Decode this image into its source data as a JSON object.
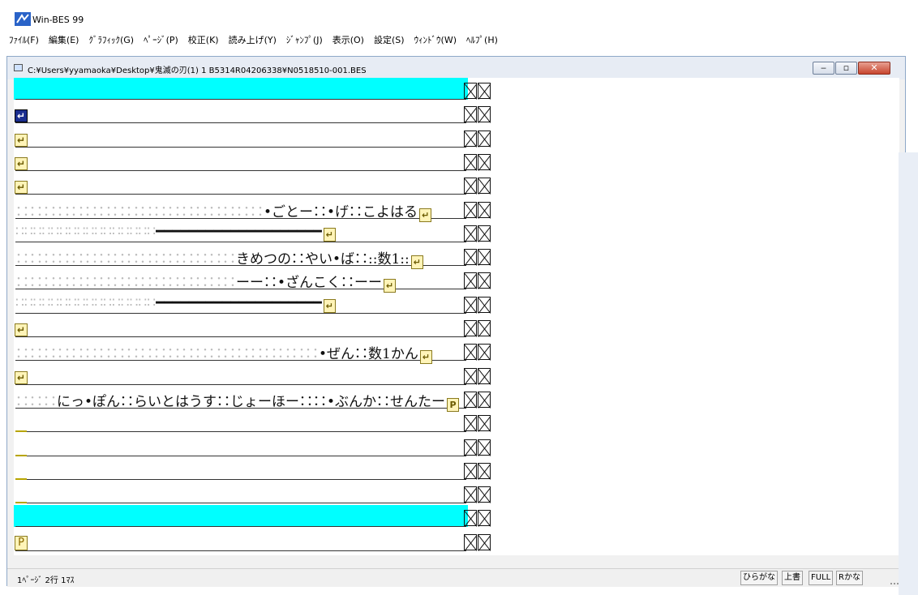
{
  "app": {
    "title": "Win-BES 99"
  },
  "menu": [
    "ﾌｧｲﾙ(F)",
    "編集(E)",
    "ｸﾞﾗﾌｨｯｸ(G)",
    "ﾍﾟｰｼﾞ(P)",
    "校正(K)",
    "読み上げ(Y)",
    "ｼﾞｬﾝﾌﾟ(J)",
    "表示(O)",
    "設定(S)",
    "ｳｨﾝﾄﾞｳ(W)",
    "ﾍﾙﾌﾟ(H)"
  ],
  "document": {
    "title": "C:¥Users¥yyamaoka¥Desktop¥鬼滅の刃(1) 1 B5314R04206338¥N0518510-001.BES",
    "rows": [
      {
        "kind": "highlight",
        "text": ""
      },
      {
        "kind": "return-cursor",
        "text": ""
      },
      {
        "kind": "return",
        "text": ""
      },
      {
        "kind": "return",
        "text": ""
      },
      {
        "kind": "return",
        "text": ""
      },
      {
        "kind": "text",
        "lead": "∷∷∷∷∷∷∷∷∷∷∷∷∷∷∷∷∷∷",
        "text": "•ごとー∷•げ∷こよはる",
        "end": "return"
      },
      {
        "kind": "text",
        "lead": "∷∷∷∷∷∷∷∷∷∷∷∷∷∷∷∷",
        "text": "━━━━━━━━━━━━━━━━━━━━",
        "end": "return"
      },
      {
        "kind": "text",
        "lead": "∷∷∷∷∷∷∷∷∷∷∷∷∷∷∷∷",
        "text": "きめつの∷やい•ば∷::数1::",
        "end": "return"
      },
      {
        "kind": "text",
        "lead": "∷∷∷∷∷∷∷∷∷∷∷∷∷∷∷∷",
        "text": "ーー∷•ざんこく∷ーー",
        "end": "return"
      },
      {
        "kind": "text",
        "lead": "∷∷∷∷∷∷∷∷∷∷∷∷∷∷∷∷",
        "text": "━━━━━━━━━━━━━━━━━━━━",
        "end": "return"
      },
      {
        "kind": "return",
        "text": ""
      },
      {
        "kind": "text",
        "lead": "∷∷∷∷∷∷∷∷∷∷∷∷∷∷∷∷∷∷∷∷∷∷",
        "text": "•ぜん∷数1かん",
        "end": "return"
      },
      {
        "kind": "return",
        "text": ""
      },
      {
        "kind": "text",
        "lead": "∷∷∷",
        "text": "にっ•ぽん∷らいとはうす∷じょーほー∷∷•ぶんか∷せんたー",
        "end": "page"
      },
      {
        "kind": "yellow",
        "text": ""
      },
      {
        "kind": "yellow",
        "text": ""
      },
      {
        "kind": "yellow",
        "text": ""
      },
      {
        "kind": "yellow",
        "text": ""
      },
      {
        "kind": "highlight",
        "text": ""
      },
      {
        "kind": "page",
        "text": ""
      }
    ]
  },
  "status": {
    "position": "1ﾍﾟｰｼﾞ 2行 1ﾏｽ",
    "modes": [
      "ひらがな",
      "上書",
      "FULL",
      "Rかな"
    ]
  },
  "controls": {
    "minimize": "‒",
    "restore": "▫",
    "close": "✕"
  },
  "icons": {
    "app": "win-bes-icon",
    "doc": "document-icon",
    "return": "return-icon",
    "page": "page-break-icon"
  }
}
